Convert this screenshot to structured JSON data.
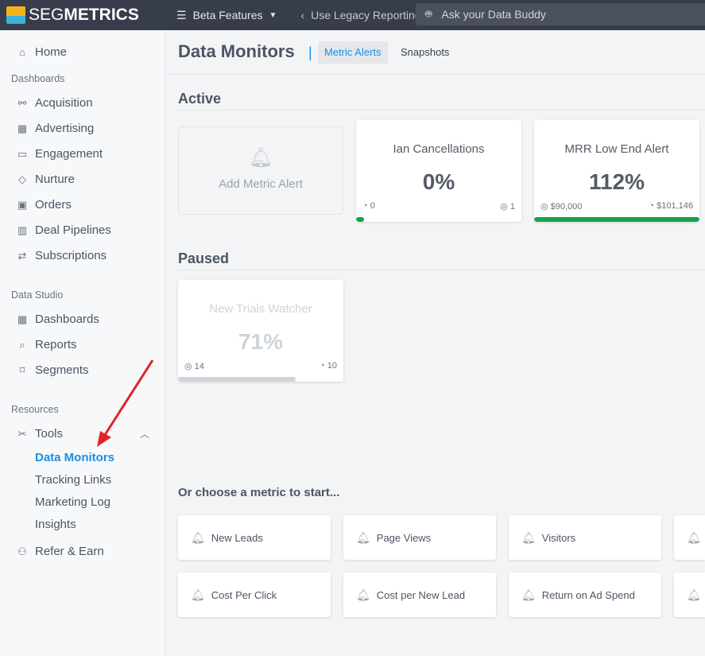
{
  "topbar": {
    "logo_light": "SEG",
    "logo_bold": "METRICS",
    "beta": "Beta Features",
    "legacy": "Use Legacy Reporting",
    "ask": "Ask your Data Buddy"
  },
  "sidebar": {
    "home": "Home",
    "dashboards_section": "Dashboards",
    "dashboards": [
      "Acquisition",
      "Advertising",
      "Engagement",
      "Nurture",
      "Orders",
      "Deal Pipelines",
      "Subscriptions"
    ],
    "studio_section": "Data Studio",
    "studio": [
      "Dashboards",
      "Reports",
      "Segments"
    ],
    "resources_section": "Resources",
    "tools": "Tools",
    "tools_sub": [
      "Data Monitors",
      "Tracking Links",
      "Marketing Log",
      "Insights"
    ],
    "refer": "Refer & Earn"
  },
  "header": {
    "title": "Data Monitors",
    "tabs": [
      "Metric Alerts",
      "Snapshots"
    ]
  },
  "active": {
    "heading": "Active",
    "add_label": "Add Metric Alert",
    "cards": [
      {
        "title": "Ian Cancellations",
        "value": "0%",
        "left": "0",
        "right": "1",
        "progress": 0.03,
        "color": "#16a34a"
      },
      {
        "title": "MRR Low End Alert",
        "value": "112%",
        "left": "$90,000",
        "right": "$101,146",
        "progress": 1,
        "color": "#16a34a"
      }
    ]
  },
  "paused": {
    "heading": "Paused",
    "cards": [
      {
        "title": "New Trials Watcher",
        "value": "71%",
        "left": "14",
        "right": "10",
        "progress": 0.71,
        "color": "#d1d5db"
      }
    ]
  },
  "choose": {
    "heading": "Or choose a metric to start...",
    "metrics": [
      "New Leads",
      "Page Views",
      "Visitors",
      "",
      "Cost Per Click",
      "Cost per New Lead",
      "Return on Ad Spend",
      ""
    ]
  }
}
